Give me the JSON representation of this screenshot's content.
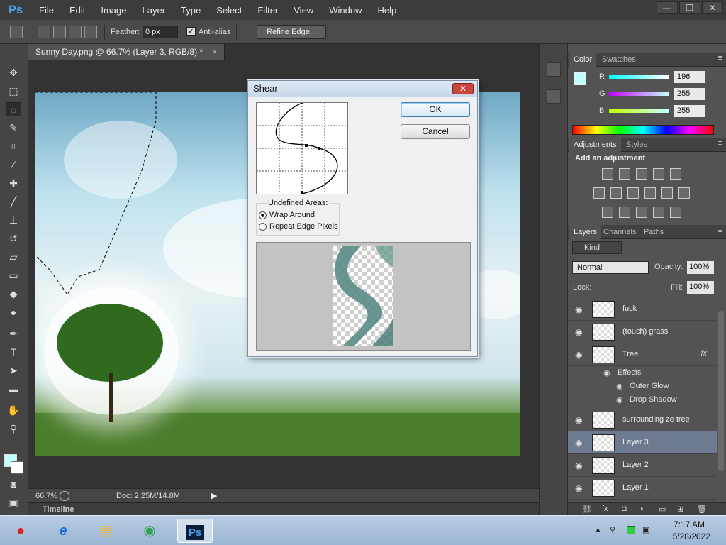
{
  "app": {
    "logo": "Ps"
  },
  "menu": [
    "File",
    "Edit",
    "Image",
    "Layer",
    "Type",
    "Select",
    "Filter",
    "View",
    "Window",
    "Help"
  ],
  "window_buttons": [
    "—",
    "❐",
    "✕"
  ],
  "options": {
    "feather_label": "Feather:",
    "feather_value": "0 px",
    "antialias_label": "Anti-alias",
    "refine_edge": "Refine Edge..."
  },
  "document": {
    "tab_title": "Sunny Day.png @ 66.7% (Layer 3, RGB/8) *",
    "tab_close": "×"
  },
  "status": {
    "zoom": "66.7%",
    "doc_info": "Doc: 2.25M/14.8M"
  },
  "timeline": {
    "label": "Timeline"
  },
  "color_panel": {
    "tabs": [
      "Color",
      "Swatches"
    ],
    "channels": [
      {
        "label": "R",
        "value": "196",
        "color": "#ff4444"
      },
      {
        "label": "G",
        "value": "255",
        "color": "#44ff44"
      },
      {
        "label": "B",
        "value": "255",
        "color": "#4488ff"
      }
    ],
    "foreground": "#c4ffff"
  },
  "adjustments": {
    "tabs": [
      "Adjustments",
      "Styles"
    ],
    "title": "Add an adjustment"
  },
  "layers_panel": {
    "tabs": [
      "Layers",
      "Channels",
      "Paths"
    ],
    "kind": "Kind",
    "blend_mode": "Normal",
    "opacity_label": "Opacity:",
    "opacity": "100%",
    "lock_label": "Lock:",
    "fill_label": "Fill:",
    "fill": "100%",
    "layers": [
      {
        "name": "fuck",
        "fx": ""
      },
      {
        "name": "(touch) grass",
        "fx": ""
      },
      {
        "name": "Tree",
        "fx": "fx"
      },
      {
        "name": "surrounding ze tree",
        "fx": ""
      },
      {
        "name": "Layer 3",
        "fx": "",
        "selected": true
      },
      {
        "name": "Layer 2",
        "fx": ""
      },
      {
        "name": "Layer 1",
        "fx": ""
      }
    ],
    "effects_label": "Effects",
    "effects": [
      "Outer Glow",
      "Drop Shadow"
    ]
  },
  "dialog": {
    "title": "Shear",
    "close": "✕",
    "ok": "OK",
    "cancel": "Cancel",
    "undefined_areas": "Undefined Areas:",
    "options": [
      {
        "label": "Wrap Around",
        "checked": true
      },
      {
        "label": "Repeat Edge Pixels",
        "checked": false
      }
    ]
  },
  "taskbar": {
    "apps": [
      {
        "icon": "angry-birds-icon",
        "glyph": "●",
        "color": "#d9231f"
      },
      {
        "icon": "internet-explorer-icon",
        "glyph": "e",
        "color": "#1b6fd1"
      },
      {
        "icon": "explorer-folder-icon",
        "glyph": "▤",
        "color": "#e6b84a"
      },
      {
        "icon": "chrome-icon",
        "glyph": "◉",
        "color": "#2da14b"
      },
      {
        "icon": "photoshop-icon",
        "glyph": "Ps",
        "color": "#4aa0e8"
      }
    ],
    "time": "7:17 AM",
    "date": "5/28/2022"
  }
}
